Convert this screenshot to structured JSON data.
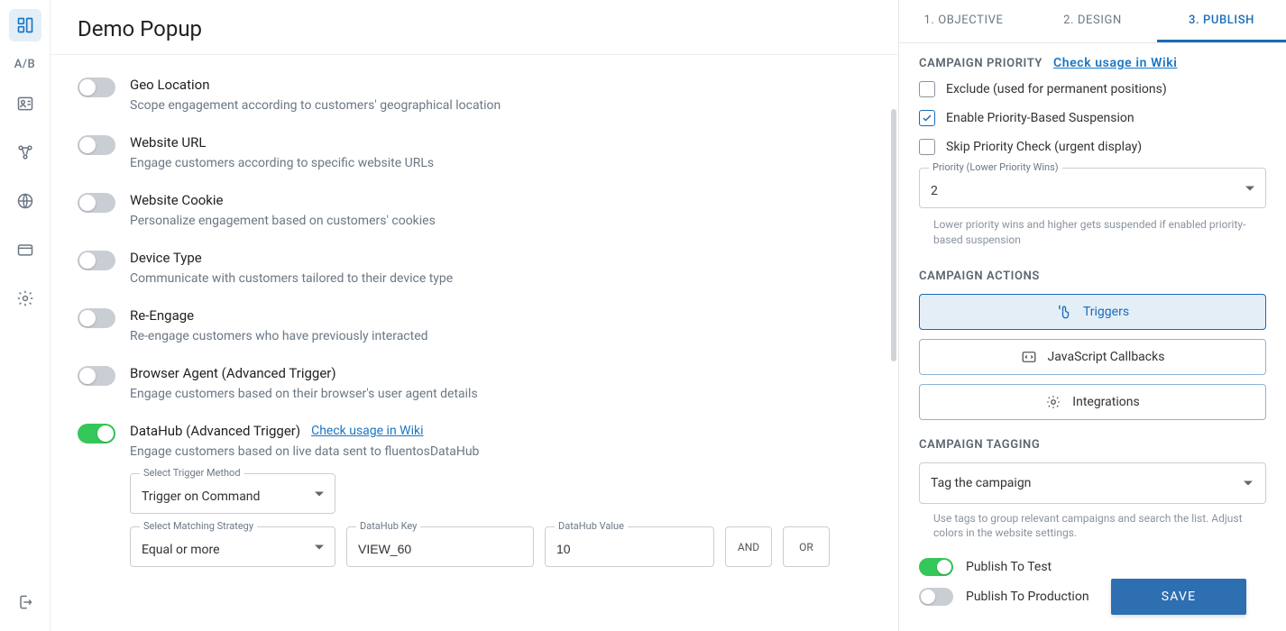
{
  "leftnav": {
    "ab": "A/B"
  },
  "title": "Demo Popup",
  "triggers": [
    {
      "label": "Geo Location",
      "desc": "Scope engagement according to customers' geographical location",
      "on": false
    },
    {
      "label": "Website URL",
      "desc": "Engage customers according to specific website URLs",
      "on": false
    },
    {
      "label": "Website Cookie",
      "desc": "Personalize engagement based on customers' cookies",
      "on": false
    },
    {
      "label": "Device Type",
      "desc": "Communicate with customers tailored to their device type",
      "on": false
    },
    {
      "label": "Re-Engage",
      "desc": "Re-engage customers who have previously interacted",
      "on": false
    },
    {
      "label": "Browser Agent (Advanced Trigger)",
      "desc": "Engage customers based on their browser's user agent details",
      "on": false
    },
    {
      "label": "DataHub (Advanced Trigger)",
      "desc": "Engage customers based on live data sent to fluentosDataHub",
      "on": true,
      "wiki": "Check usage in Wiki"
    }
  ],
  "datahub": {
    "method_label": "Select Trigger Method",
    "method_value": "Trigger on Command",
    "strategy_label": "Select Matching Strategy",
    "strategy_value": "Equal or more",
    "key_label": "DataHub Key",
    "key_value": "VIEW_60",
    "value_label": "DataHub Value",
    "value_value": "10",
    "and": "AND",
    "or": "OR"
  },
  "tabs": [
    "1. OBJECTIVE",
    "2. DESIGN",
    "3. PUBLISH"
  ],
  "priority": {
    "head": "CAMPAIGN PRIORITY",
    "wiki": "Check usage in Wiki",
    "opt1": "Exclude (used for permanent positions)",
    "opt2": "Enable Priority-Based Suspension",
    "opt3": "Skip Priority Check (urgent display)",
    "sel_label": "Priority (Lower Priority Wins)",
    "sel_value": "2",
    "hint": "Lower priority wins and higher gets suspended if enabled priority-based suspension"
  },
  "actions": {
    "head": "CAMPAIGN ACTIONS",
    "triggers": "Triggers",
    "js": "JavaScript Callbacks",
    "integrations": "Integrations"
  },
  "tagging": {
    "head": "CAMPAIGN TAGGING",
    "placeholder": "Tag the campaign",
    "hint": "Use tags to group relevant campaigns and search the list. Adjust colors in the website settings."
  },
  "publish": {
    "test": "Publish To Test",
    "prod": "Publish To Production",
    "save": "SAVE"
  }
}
